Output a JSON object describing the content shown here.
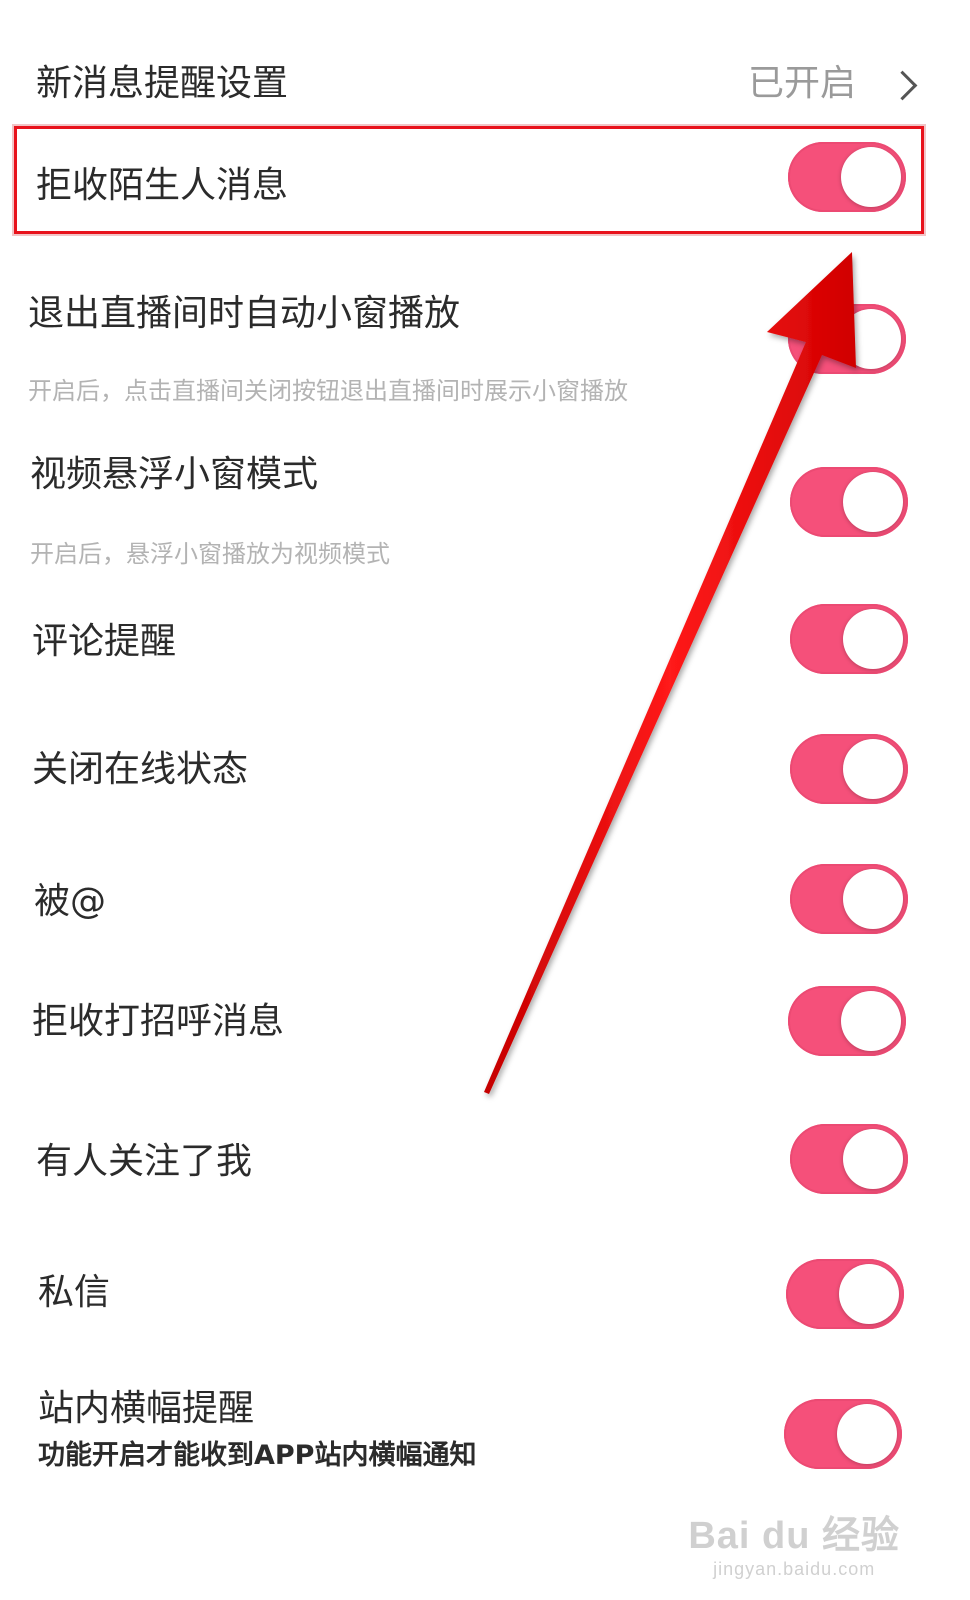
{
  "header": {
    "title": "新消息提醒设置",
    "status": "已开启",
    "chevron_icon": "chevron-right-icon"
  },
  "settings": [
    {
      "title": "拒收陌生人消息",
      "subtitle": "",
      "toggle_on": true
    },
    {
      "title": "退出直播间时自动小窗播放",
      "subtitle": "开启后，点击直播间关闭按钮退出直播间时展示小窗播放",
      "toggle_on": true
    },
    {
      "title": "视频悬浮小窗模式",
      "subtitle": "开启后，悬浮小窗播放为视频模式",
      "toggle_on": true
    },
    {
      "title": "评论提醒",
      "subtitle": "",
      "toggle_on": true
    },
    {
      "title": "关闭在线状态",
      "subtitle": "",
      "toggle_on": true
    },
    {
      "title": "被@",
      "subtitle": "",
      "toggle_on": true
    },
    {
      "title": "拒收打招呼消息",
      "subtitle": "",
      "toggle_on": true
    },
    {
      "title": "有人关注了我",
      "subtitle": "",
      "toggle_on": true
    },
    {
      "title": "私信",
      "subtitle": "",
      "toggle_on": true
    },
    {
      "title": "站内横幅提醒",
      "subtitle": "功能开启才能收到APP站内横幅通知",
      "toggle_on": true
    }
  ],
  "annotation": {
    "highlight_color": "#e8121b",
    "arrow_color": "#ff0000"
  },
  "watermark": {
    "main": "Bai du 经验",
    "url": "jingyan.baidu.com"
  },
  "colors": {
    "toggle_on": "#f5507a",
    "text": "#2b2b2b",
    "subtext": "#b3b3b3"
  }
}
